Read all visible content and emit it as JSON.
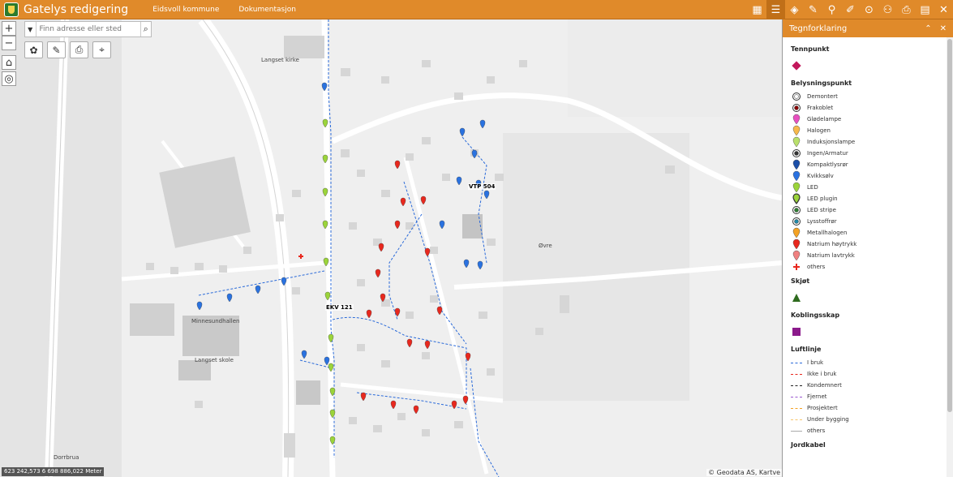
{
  "header": {
    "title": "Gatelys redigering",
    "nav": [
      "Eidsvoll kommune",
      "Dokumentasjon"
    ],
    "tool_icons": [
      "grid-icon",
      "list-icon",
      "layers-icon",
      "edit-icon",
      "pin-icon",
      "pin-edit-icon",
      "target-icon",
      "search-person-icon",
      "print-icon",
      "book-icon",
      "close-icon"
    ]
  },
  "search": {
    "placeholder": "Finn adresse eller sted"
  },
  "map": {
    "coordinates": "623 242,573 6 698 886,022 Meter",
    "attribution": "© Geodata AS, Kartve",
    "labels": {
      "church": "Langset kirke",
      "hall": "Minnesundhallen",
      "school": "Langset skole",
      "road_dorr": "Dorrbrua",
      "road_ovre": "Øvre",
      "ekv": "EKV 121",
      "vtp": "VTP 504"
    }
  },
  "legend": {
    "title": "Tegnforklaring",
    "sections": [
      {
        "title": "Tennpunkt",
        "items": [
          {
            "label": "",
            "color": "#c2185b",
            "shape": "diamond"
          }
        ]
      },
      {
        "title": "Belysningspunkt",
        "items": [
          {
            "label": "Demontert",
            "color": "#ffffff",
            "shape": "ring-dot"
          },
          {
            "label": "Frakoblet",
            "color": "#8b0000",
            "shape": "ring-dot"
          },
          {
            "label": "Glødelampe",
            "color": "#e84fc0",
            "shape": "pin"
          },
          {
            "label": "Halogen",
            "color": "#f7b84a",
            "shape": "pin"
          },
          {
            "label": "Induksjonslampe",
            "color": "#b9e06b",
            "shape": "pin"
          },
          {
            "label": "Ingen/Armatur",
            "color": "#333333",
            "shape": "ring-dot"
          },
          {
            "label": "Kompaktlysrør",
            "color": "#1c4fa8",
            "shape": "pin"
          },
          {
            "label": "Kvikksølv",
            "color": "#2a72e0",
            "shape": "pin"
          },
          {
            "label": "LED",
            "color": "#9bd43a",
            "shape": "pin"
          },
          {
            "label": "LED plugin",
            "color": "#9bd43a",
            "shape": "pin-outline"
          },
          {
            "label": "LED stripe",
            "color": "#2e7d32",
            "shape": "ring-dot"
          },
          {
            "label": "Lysstoffrør",
            "color": "#1e88a8",
            "shape": "ring-dot"
          },
          {
            "label": "Metallhalogen",
            "color": "#f4a223",
            "shape": "pin"
          },
          {
            "label": "Natrium høytrykk",
            "color": "#e8281e",
            "shape": "pin"
          },
          {
            "label": "Natrium lavtrykk",
            "color": "#f08080",
            "shape": "pin"
          },
          {
            "label": "others",
            "color": "#e8281e",
            "shape": "cross"
          }
        ]
      },
      {
        "title": "Skjøt",
        "items": [
          {
            "label": "",
            "color": "#2e6b1e",
            "shape": "triangle"
          }
        ]
      },
      {
        "title": "Koblingsskap",
        "items": [
          {
            "label": "",
            "color": "#8b1a8b",
            "shape": "square"
          }
        ]
      },
      {
        "title": "Luftlinje",
        "items": [
          {
            "label": "I bruk",
            "color": "#2a6ad9",
            "shape": "dash"
          },
          {
            "label": "Ikke i bruk",
            "color": "#e8281e",
            "shape": "dash"
          },
          {
            "label": "Kondemnert",
            "color": "#222222",
            "shape": "dash"
          },
          {
            "label": "Fjernet",
            "color": "#9b59d0",
            "shape": "dash"
          },
          {
            "label": "Prosjektert",
            "color": "#f4a223",
            "shape": "dash"
          },
          {
            "label": "Under bygging",
            "color": "#f7c66b",
            "shape": "dash"
          },
          {
            "label": "others",
            "color": "#aaaaaa",
            "shape": "solid"
          }
        ]
      },
      {
        "title": "Jordkabel",
        "items": []
      }
    ]
  }
}
